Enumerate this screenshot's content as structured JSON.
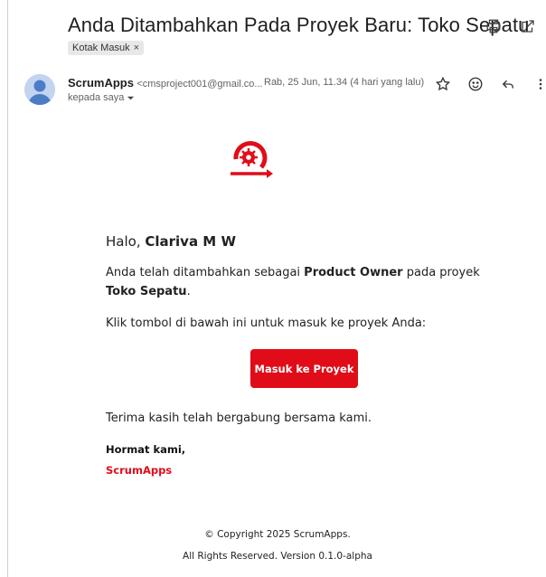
{
  "email": {
    "subject": "Anda Ditambahkan Pada Proyek Baru: Toko Sepatu",
    "label": "Kotak Masuk",
    "label_close": "×",
    "sender_name": "ScrumApps",
    "sender_email": "<cmsproject001@gmail.co...",
    "date": "Rab, 25 Jun, 11.34 (4 hari yang lalu)",
    "recipient": "kepada saya",
    "icons": {
      "print": "print-icon",
      "open_new_window": "open-in-new-window-icon",
      "star": "star-icon",
      "emoji": "emoji-icon",
      "reply": "reply-icon",
      "more": "more-vert-icon",
      "recipient_dropdown": "chevron-down-icon",
      "avatar": "avatar-icon",
      "logo": "scrumapps-logo-icon"
    }
  },
  "body": {
    "greeting_prefix": "Halo, ",
    "greeting_name": "Clariva M W",
    "line1_a": "Anda telah ditambahkan sebagai ",
    "line1_role": "Product Owner",
    "line1_b": " pada proyek ",
    "line1_project": "Toko Sepatu",
    "line1_c": ".",
    "line2": "Klik tombol di bawah ini untuk masuk ke proyek Anda:",
    "button_label": "Masuk ke Proyek",
    "thanks": "Terima kasih telah bergabung bersama kami.",
    "regards": "Hormat kami,",
    "brand": "ScrumApps"
  },
  "footer": {
    "copyright": "© Copyright 2025 ScrumApps.",
    "version": "All Rights Reserved. Version 0.1.0-alpha"
  },
  "colors": {
    "accent": "#e00d19",
    "text": "#1f1f1f",
    "muted": "#5f6368"
  }
}
